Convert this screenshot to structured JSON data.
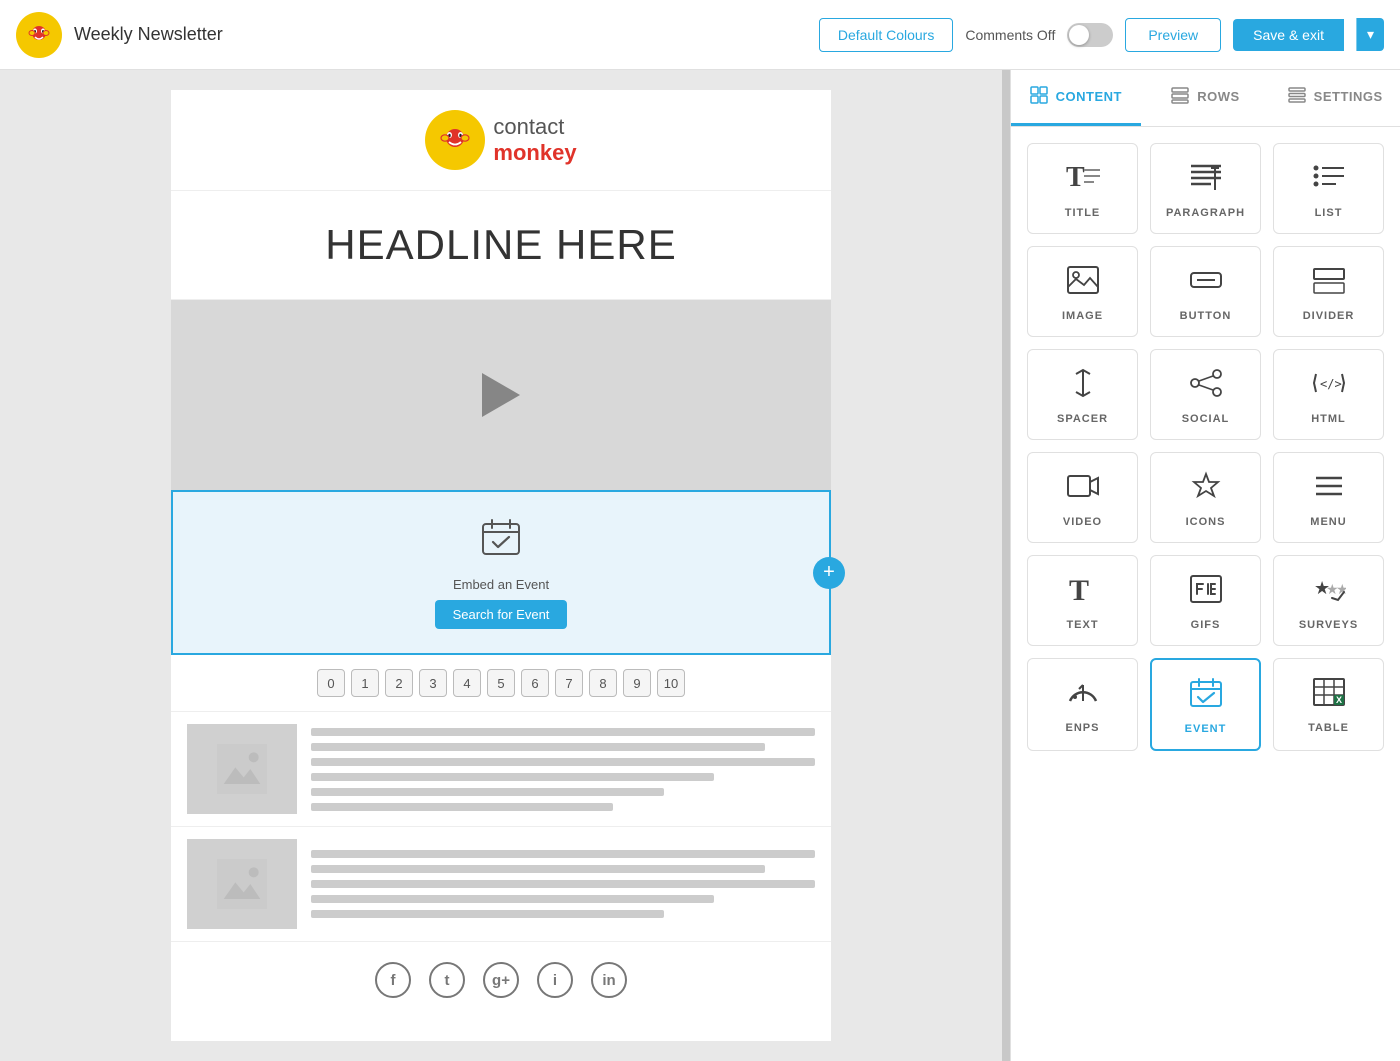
{
  "topbar": {
    "title": "Weekly Newsletter",
    "default_colours_label": "Default Colours",
    "comments_label": "Comments Off",
    "preview_label": "Preview",
    "save_label": "Save & exit"
  },
  "panel": {
    "tabs": [
      {
        "id": "content",
        "label": "CONTENT",
        "active": true
      },
      {
        "id": "rows",
        "label": "ROWS",
        "active": false
      },
      {
        "id": "settings",
        "label": "SETTINGS",
        "active": false
      }
    ],
    "content_items": [
      {
        "id": "title",
        "label": "TITLE"
      },
      {
        "id": "paragraph",
        "label": "PARAGRAPH"
      },
      {
        "id": "list",
        "label": "LIST"
      },
      {
        "id": "image",
        "label": "IMAGE"
      },
      {
        "id": "button",
        "label": "BUTTON"
      },
      {
        "id": "divider",
        "label": "DIVIDER"
      },
      {
        "id": "spacer",
        "label": "SPACER"
      },
      {
        "id": "social",
        "label": "SOCIAL"
      },
      {
        "id": "html",
        "label": "HTML"
      },
      {
        "id": "video",
        "label": "VIDEO"
      },
      {
        "id": "icons",
        "label": "ICONS"
      },
      {
        "id": "menu",
        "label": "MENU"
      },
      {
        "id": "text",
        "label": "TEXT"
      },
      {
        "id": "gifs",
        "label": "GIFS"
      },
      {
        "id": "surveys",
        "label": "SURVEYS"
      },
      {
        "id": "enps",
        "label": "ENPS"
      },
      {
        "id": "event",
        "label": "EVENT",
        "active": true
      },
      {
        "id": "table",
        "label": "TABLE"
      }
    ]
  },
  "canvas": {
    "headline": "HEADLINE HERE",
    "event_label": "Embed an Event",
    "search_button": "Search for Event",
    "pagination": [
      "0",
      "1",
      "2",
      "3",
      "4",
      "5",
      "6",
      "7",
      "8",
      "9",
      "10"
    ],
    "social_icons": [
      "f",
      "t",
      "g+",
      "i",
      "in"
    ]
  }
}
